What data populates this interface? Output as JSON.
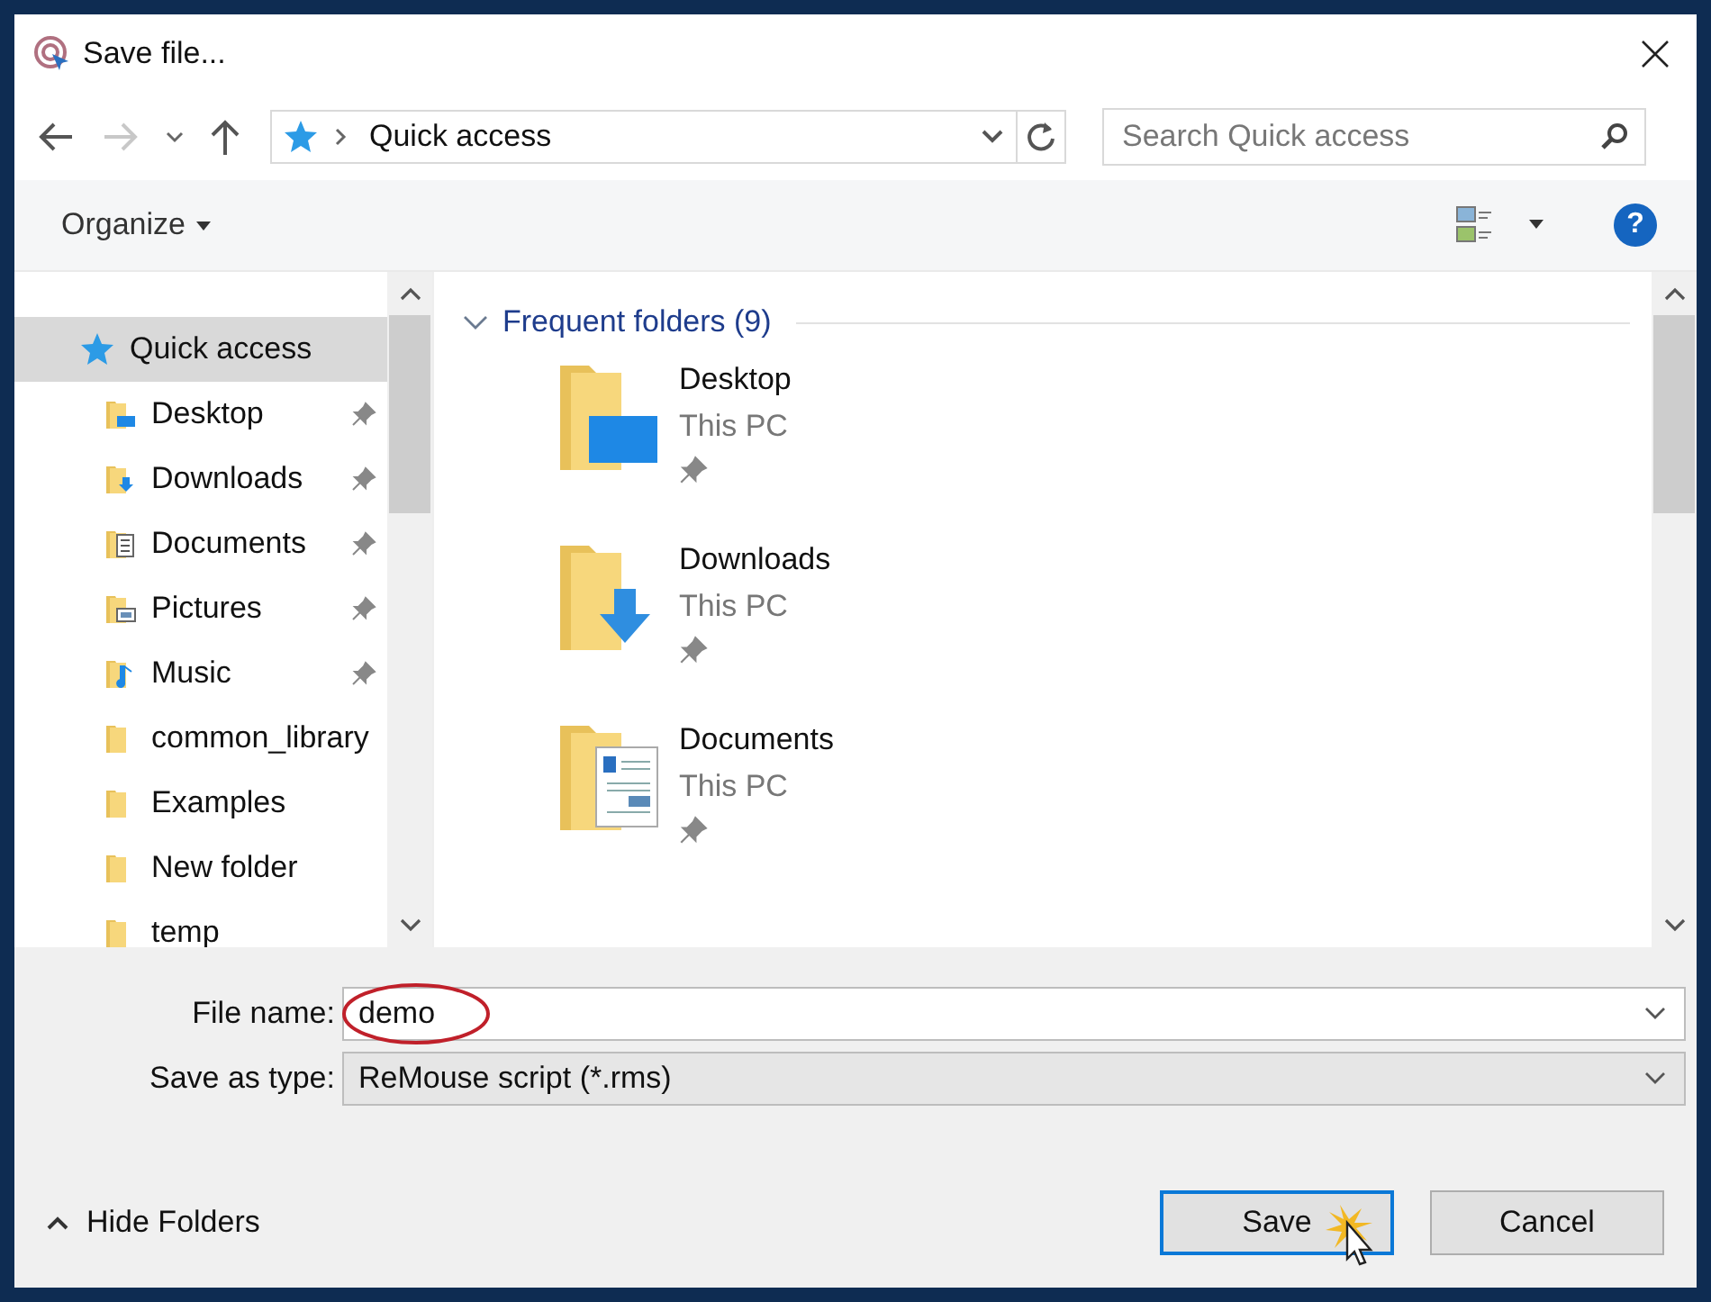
{
  "window": {
    "title": "Save file..."
  },
  "address_bar": {
    "location": "Quick access"
  },
  "search": {
    "placeholder": "Search Quick access"
  },
  "toolbar": {
    "organize": "Organize",
    "help": "?"
  },
  "sidebar": {
    "items": [
      {
        "label": "Quick access",
        "kind": "star",
        "pinned": false,
        "selected": true
      },
      {
        "label": "Desktop",
        "kind": "desktop",
        "pinned": true,
        "selected": false
      },
      {
        "label": "Downloads",
        "kind": "downloads",
        "pinned": true,
        "selected": false
      },
      {
        "label": "Documents",
        "kind": "documents",
        "pinned": true,
        "selected": false
      },
      {
        "label": "Pictures",
        "kind": "pictures",
        "pinned": true,
        "selected": false
      },
      {
        "label": "Music",
        "kind": "music",
        "pinned": true,
        "selected": false
      },
      {
        "label": "common_library",
        "kind": "folder",
        "pinned": false,
        "selected": false
      },
      {
        "label": "Examples",
        "kind": "folder",
        "pinned": false,
        "selected": false
      },
      {
        "label": "New folder",
        "kind": "folder",
        "pinned": false,
        "selected": false
      },
      {
        "label": "temp",
        "kind": "folder",
        "pinned": false,
        "selected": false
      }
    ]
  },
  "content": {
    "group": {
      "title": "Frequent folders (9)",
      "expanded": true
    },
    "folders": [
      {
        "name": "Desktop",
        "location": "This PC",
        "kind": "desktop",
        "pinned": true
      },
      {
        "name": "Downloads",
        "location": "This PC",
        "kind": "downloads",
        "pinned": true
      },
      {
        "name": "Documents",
        "location": "This PC",
        "kind": "documents",
        "pinned": true
      }
    ]
  },
  "form": {
    "file_name_label": "File name:",
    "file_name": "demo",
    "type_label": "Save as type:",
    "type": "ReMouse script (*.rms)"
  },
  "footer": {
    "hide_folders": "Hide Folders",
    "buttons": [
      {
        "label": "Save",
        "default": true
      },
      {
        "label": "Cancel",
        "default": false
      }
    ]
  }
}
